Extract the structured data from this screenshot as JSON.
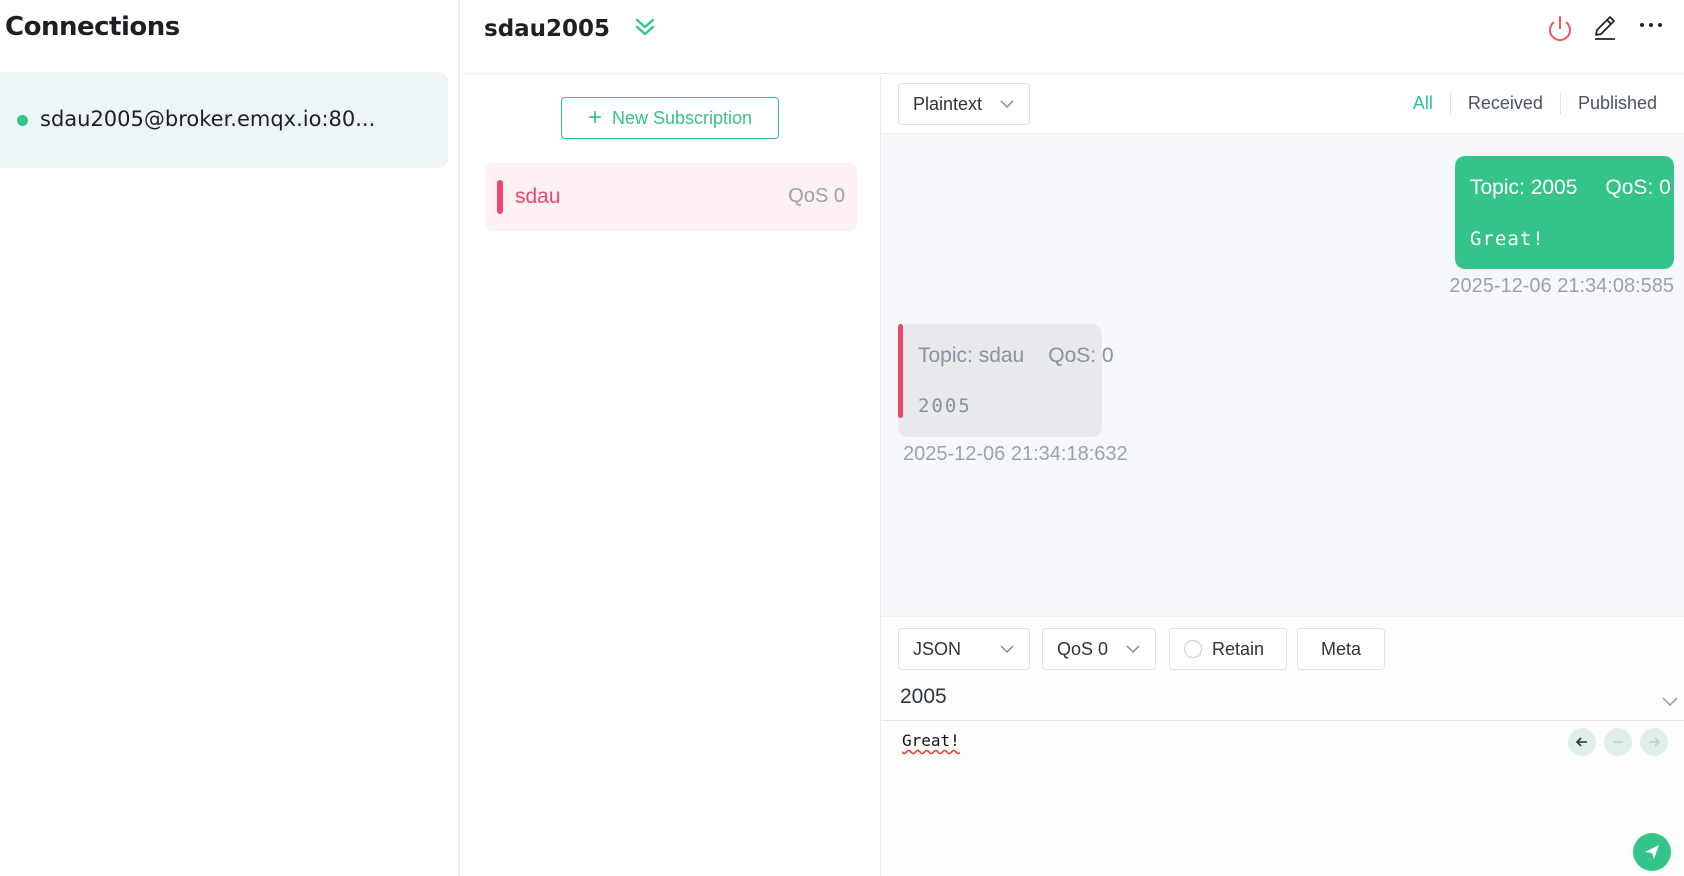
{
  "connections": {
    "title": "Connections",
    "items": [
      {
        "name": "sdau2005@broker.emqx.io:80...",
        "status": "connected"
      }
    ]
  },
  "header": {
    "title": "sdau2005"
  },
  "subscriptions": {
    "new_button_label": "New Subscription",
    "items": [
      {
        "topic": "sdau",
        "qos": "QoS 0",
        "color": "#f0466b"
      }
    ]
  },
  "messages": {
    "format": "Plaintext",
    "filters": [
      "All",
      "Received",
      "Published"
    ],
    "active_filter": "All",
    "items": [
      {
        "direction": "published",
        "topic_label": "Topic: 2005",
        "qos_label": "QoS: 0",
        "payload": "Great!",
        "time": "2025-12-06 21:34:08:585"
      },
      {
        "direction": "received",
        "topic_label": "Topic: sdau",
        "qos_label": "QoS: 0",
        "payload": "2005",
        "time": "2025-12-06 21:34:18:632"
      }
    ]
  },
  "publish": {
    "payload_format": "JSON",
    "qos": "QoS 0",
    "retain_label": "Retain",
    "meta_label": "Meta",
    "topic": "2005",
    "payload": "Great!"
  },
  "colors": {
    "accent": "#34c388",
    "subscription": "#f0466b"
  },
  "icons": {
    "header": [
      "chevrons-down-icon",
      "power-icon",
      "edit-icon",
      "more-icon"
    ],
    "publish": [
      "arrow-left-icon",
      "minus-icon",
      "arrow-right-icon",
      "send-icon"
    ]
  }
}
